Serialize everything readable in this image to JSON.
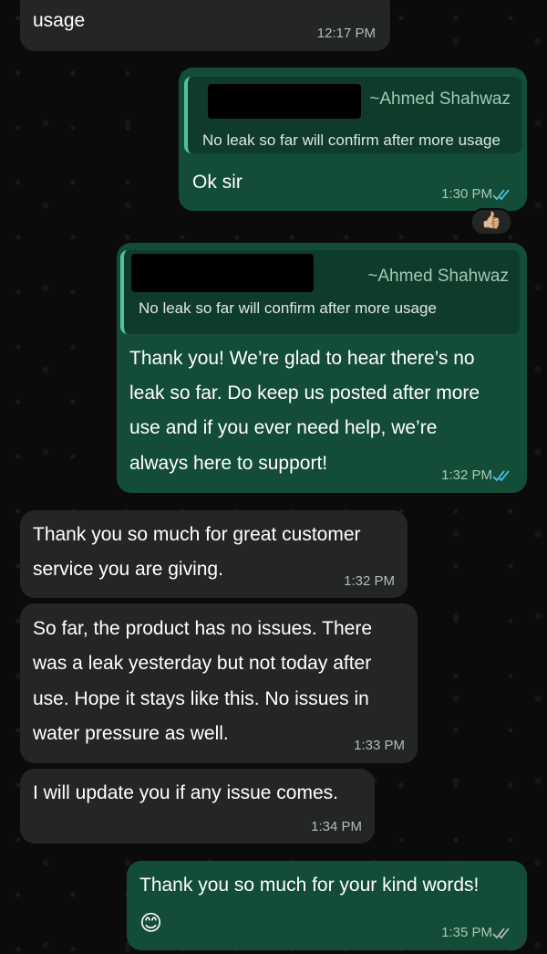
{
  "messages": [
    {
      "text": "usage",
      "time": "12:17 PM"
    },
    {
      "reply_author": "~Ahmed Shahwaz",
      "reply_text": "No leak so far will confirm after more usage",
      "text": "Ok sir",
      "time": "1:30 PM",
      "reaction": "👍🏼"
    },
    {
      "reply_author": "~Ahmed Shahwaz",
      "reply_text": "No leak so far will confirm after more usage",
      "lines": [
        "Thank you! We’re glad to hear there’s no",
        "leak so far. Do keep us posted after more",
        "use and if you ever need help, we’re",
        "always here to support!"
      ],
      "time": "1:32 PM"
    },
    {
      "lines": [
        "Thank you so much for great customer",
        "service you are giving."
      ],
      "time": "1:32 PM"
    },
    {
      "lines": [
        "So far, the product has no issues. There",
        "was a leak yesterday but not today after",
        "use. Hope it stays like this. No issues in",
        "water pressure as well."
      ],
      "time": "1:33 PM"
    },
    {
      "text": "I will update you if any issue comes.",
      "time": "1:34 PM"
    },
    {
      "text": "Thank you so much for your kind words!",
      "emoji": "😊",
      "time": "1:35 PM"
    }
  ],
  "colors": {
    "incoming": "#242626",
    "outgoing": "#134d37",
    "read_ticks": "#53bdeb",
    "sent_ticks": "#aeb8b3"
  }
}
